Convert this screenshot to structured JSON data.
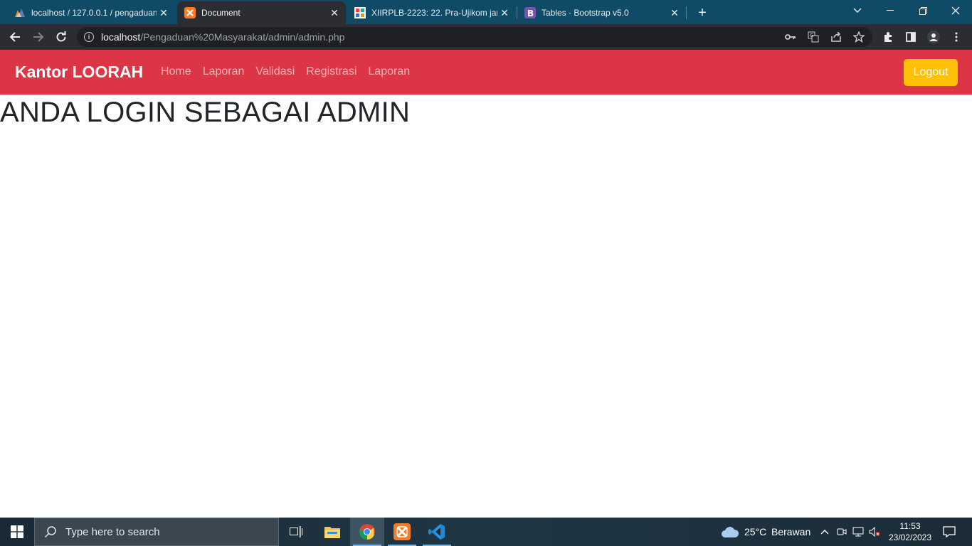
{
  "browser": {
    "tabs": [
      {
        "title": "localhost / 127.0.0.1 / pengaduan",
        "favicon": "phpmyadmin-icon",
        "active": false
      },
      {
        "title": "Document",
        "favicon": "xampp-icon",
        "active": true
      },
      {
        "title": "XIIRPLB-2223: 22. Pra-Ujikom jar",
        "favicon": "moodle-icon",
        "active": false
      },
      {
        "title": "Tables · Bootstrap v5.0",
        "favicon": "bootstrap-icon",
        "active": false
      }
    ],
    "new_tab_label": "+",
    "close_glyph": "✕",
    "url_host": "localhost",
    "url_path": "/Pengaduan%20Masyarakat/admin/admin.php"
  },
  "navbar": {
    "brand": "Kantor LOORAH",
    "links": [
      "Home",
      "Laporan",
      "Validasi",
      "Registrasi",
      "Laporan"
    ],
    "logout_label": "Logout",
    "colors": {
      "bar": "#dc3545",
      "logout": "#ffc107"
    }
  },
  "main": {
    "heading": "ANDA LOGIN SEBAGAI ADMIN"
  },
  "taskbar": {
    "search_placeholder": "Type here to search",
    "weather_temp": "25°C",
    "weather_desc": "Berawan",
    "time": "11:53",
    "date": "23/02/2023"
  }
}
